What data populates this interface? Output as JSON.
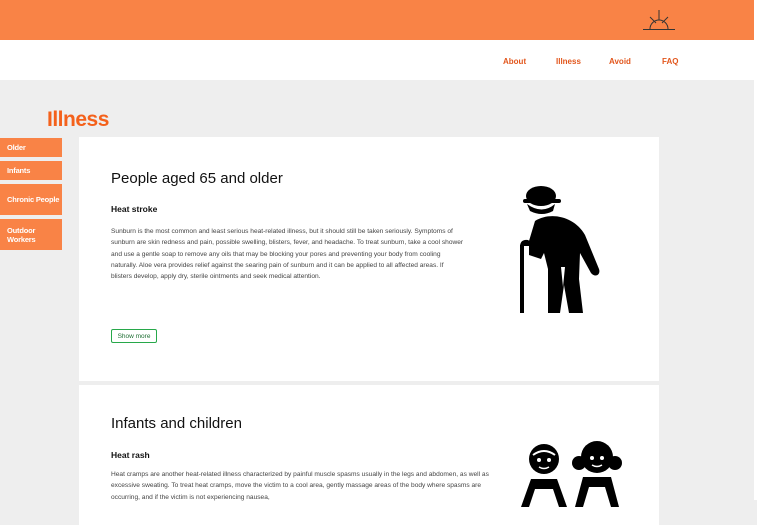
{
  "header": {
    "logo_icon": "sunrise-icon",
    "background": "#f98346"
  },
  "nav": {
    "items": [
      {
        "label": "About"
      },
      {
        "label": "Illness"
      },
      {
        "label": "Avoid"
      },
      {
        "label": "FAQ"
      }
    ],
    "link_color": "#e2561c"
  },
  "page": {
    "title": "Illness",
    "title_color": "#f4611b"
  },
  "sidebar": {
    "items": [
      {
        "label": "Older"
      },
      {
        "label": "Infants"
      },
      {
        "label": "Chronic People"
      },
      {
        "label": "Outdoor Workers"
      }
    ]
  },
  "cards": [
    {
      "title": "People aged 65 and older",
      "subtitle": "Heat stroke",
      "body": "Sunburn is the most common and least serious heat-related illness, but it should still be taken seriously. Symptoms of sunburn are skin redness and pain, possible swelling, blisters, fever, and headache. To treat sunburn, take a cool shower and use a gentle soap to remove any oils that may be blocking your pores and preventing your body from cooling naturally. Aloe vera provides relief against the searing pain of sunburn and it can be applied to all affected areas. If blisters develop, apply dry, sterile ointments and seek medical attention.",
      "button": "Show more",
      "image_icon": "elderly-person-with-cane-icon"
    },
    {
      "title": "Infants and children",
      "subtitle": "Heat rash",
      "body": "Heat cramps are another heat-related illness characterized by painful muscle spasms usually in the legs and abdomen, as well as excessive sweating. To treat heat cramps, move the victim to a cool area, gently massage areas of the body where spasms are occurring, and if the victim is not experiencing nausea,",
      "image_icon": "two-children-icon"
    }
  ]
}
